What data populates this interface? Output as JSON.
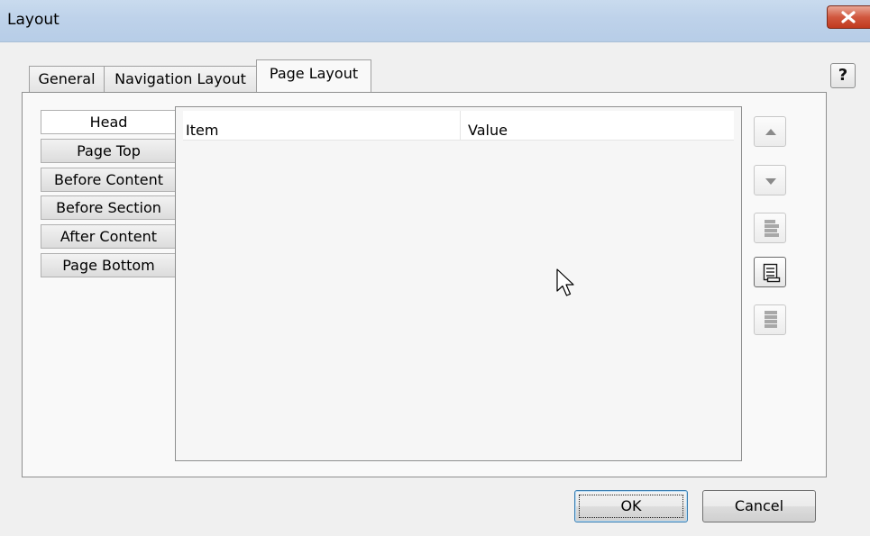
{
  "window": {
    "title": "Layout",
    "close_icon": "close-icon",
    "help_label": "?"
  },
  "tabs": [
    {
      "label": "General",
      "active": false
    },
    {
      "label": "Navigation Layout",
      "active": false
    },
    {
      "label": "Page Layout",
      "active": true
    }
  ],
  "sections": [
    {
      "label": "Head",
      "active": true
    },
    {
      "label": "Page Top",
      "active": false
    },
    {
      "label": "Before Content",
      "active": false
    },
    {
      "label": "Before Section",
      "active": false
    },
    {
      "label": "After Content",
      "active": false
    },
    {
      "label": "Page Bottom",
      "active": false
    }
  ],
  "list": {
    "columns": [
      "Item",
      "Value"
    ],
    "rows": []
  },
  "side_buttons": [
    {
      "icon": "move-up-icon",
      "enabled": false
    },
    {
      "icon": "move-down-icon",
      "enabled": false
    },
    {
      "icon": "insert-item-icon",
      "enabled": false
    },
    {
      "icon": "add-item-icon",
      "enabled": true
    },
    {
      "icon": "remove-item-icon",
      "enabled": false
    }
  ],
  "footer": {
    "ok_label": "OK",
    "cancel_label": "Cancel"
  }
}
